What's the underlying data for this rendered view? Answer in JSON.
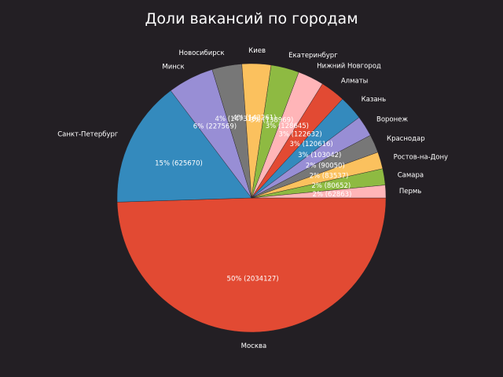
{
  "chart_data": {
    "type": "pie",
    "title": "Доли вакансий по городам",
    "start_angle_deg": 0,
    "direction": "clockwise",
    "slices": [
      {
        "label": "Москва",
        "value": 2034127,
        "pct_text": "50%  (2034127)",
        "color": "#e24a33"
      },
      {
        "label": "Санкт-Петербург",
        "value": 625670,
        "pct_text": "15%  (625670)",
        "color": "#348abd"
      },
      {
        "label": "Минск",
        "value": 227569,
        "pct_text": "6%  (227569)",
        "color": "#988ed5"
      },
      {
        "label": "Новосибирск",
        "value": 147316,
        "pct_text": "4%  (147316)",
        "color": "#777777"
      },
      {
        "label": "Киев",
        "value": 143261,
        "pct_text": "4%  (143261)",
        "color": "#fbc15e"
      },
      {
        "label": "Екатеринбург",
        "value": 138969,
        "pct_text": "3%  (138969)",
        "color": "#8eba42"
      },
      {
        "label": "Нижний Новгород",
        "value": 128645,
        "pct_text": "3%  (128645)",
        "color": "#ffb5b8"
      },
      {
        "label": "Алматы",
        "value": 122632,
        "pct_text": "3%  (122632)",
        "color": "#e24a33"
      },
      {
        "label": "Казань",
        "value": 120616,
        "pct_text": "3%  (120616)",
        "color": "#348abd"
      },
      {
        "label": "Воронеж",
        "value": 103042,
        "pct_text": "3%  (103042)",
        "color": "#988ed5"
      },
      {
        "label": "Краснодар",
        "value": 90050,
        "pct_text": "2%  (90050)",
        "color": "#777777"
      },
      {
        "label": "Ростов-на-Дону",
        "value": 83537,
        "pct_text": "2%  (83537)",
        "color": "#fbc15e"
      },
      {
        "label": "Самара",
        "value": 80652,
        "pct_text": "2%  (80652)",
        "color": "#8eba42"
      },
      {
        "label": "Пермь",
        "value": 62863,
        "pct_text": "2%  (62863)",
        "color": "#ffb5b8"
      }
    ]
  }
}
